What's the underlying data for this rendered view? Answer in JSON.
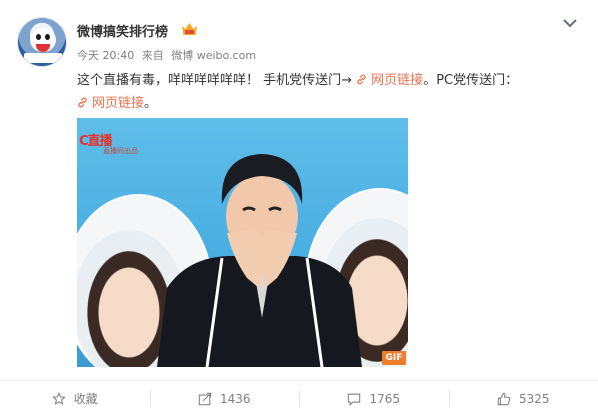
{
  "post": {
    "author": "微博搞笑排行榜",
    "time": "今天 20:40",
    "source_prefix": "来自",
    "source": "微博 weibo.com",
    "text_part1": "这个直播有毒，咩咩咩咩咩咩！ 手机党传送门→",
    "link1": "网页链接",
    "text_part2": "。PC党传送门：",
    "link2": "网页链接",
    "text_part3": "。"
  },
  "media": {
    "watermark": "C直播",
    "watermark_sub": "直播间出品",
    "badge": "GIF"
  },
  "actions": {
    "favorite": "收藏",
    "repost": "1436",
    "comment": "1765",
    "like": "5325"
  },
  "colors": {
    "link": "#eb7350",
    "meta": "#808080",
    "gif_badge": "#ee7d2e"
  },
  "icons": [
    "vip-icon",
    "chevron-down-icon",
    "link-icon",
    "star-icon",
    "repost-icon",
    "comment-icon",
    "thumbs-up-icon"
  ]
}
